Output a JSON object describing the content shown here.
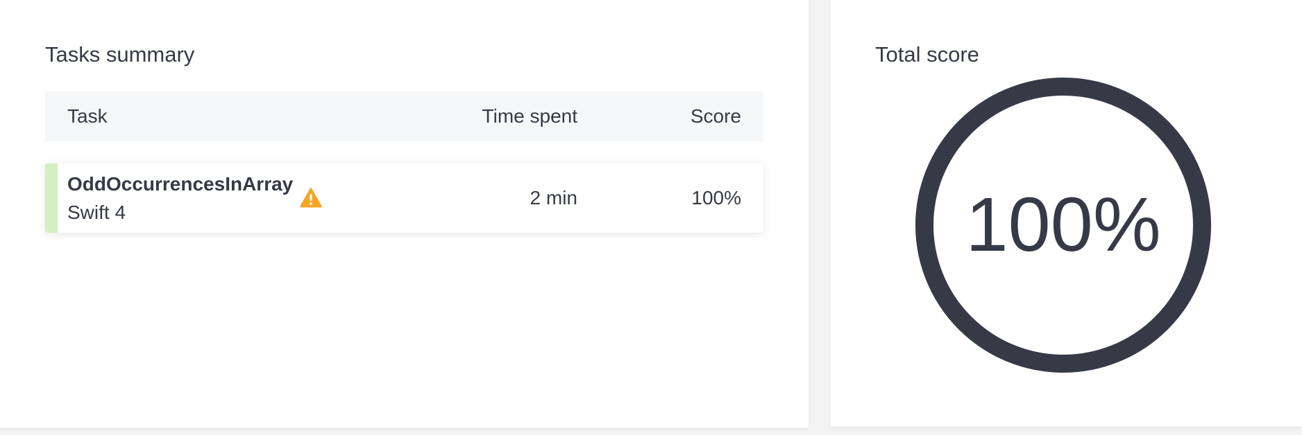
{
  "tasks_summary": {
    "title": "Tasks summary",
    "columns": {
      "task": "Task",
      "time_spent": "Time spent",
      "score": "Score"
    },
    "rows": [
      {
        "name": "OddOccurrencesInArray",
        "language": "Swift 4",
        "warning_icon": "warning-icon",
        "time_spent": "2 min",
        "score": "100%",
        "status_color": "#d4efc0"
      }
    ]
  },
  "total_score": {
    "title": "Total score",
    "value": "100%",
    "fraction": 1.0,
    "ring_color": "#373a46"
  },
  "colors": {
    "text": "#373a46",
    "warning": "#f5a623",
    "header_bg": "#f6f7f9"
  }
}
